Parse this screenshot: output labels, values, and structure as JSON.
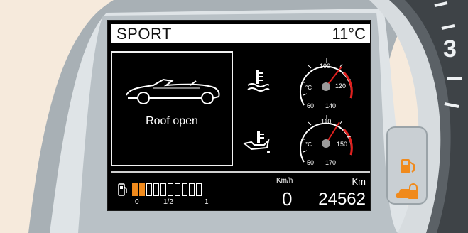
{
  "header": {
    "mode": "SPORT",
    "outside_temp": "11°C"
  },
  "status_panel": {
    "message": "Roof open",
    "icon": "convertible-car-icon"
  },
  "water_gauge": {
    "icon": "coolant-temperature-icon",
    "unit": "°C",
    "ticks": [
      "60",
      "100",
      "120",
      "140"
    ],
    "value": 105
  },
  "oil_gauge": {
    "icon": "oil-temperature-icon",
    "unit": "°C",
    "ticks": [
      "50",
      "110",
      "150",
      "170"
    ],
    "value": 120
  },
  "fuel": {
    "icon": "fuel-pump-icon",
    "level": 0.2,
    "segments": 10,
    "filled": 2,
    "labels": [
      "0",
      "1/2",
      "1"
    ]
  },
  "speed": {
    "unit": "Km/h",
    "value": "0"
  },
  "odometer": {
    "unit": "Km",
    "value": "24562"
  },
  "tachometer": {
    "digit": "3"
  },
  "warning_lights": [
    {
      "icon": "fuel-warning-icon",
      "color": "#f08a1c"
    },
    {
      "icon": "lock-warning-icon",
      "color": "#f08a1c"
    }
  ],
  "colors": {
    "accent": "#f08a1c",
    "redline": "#e0201e"
  }
}
